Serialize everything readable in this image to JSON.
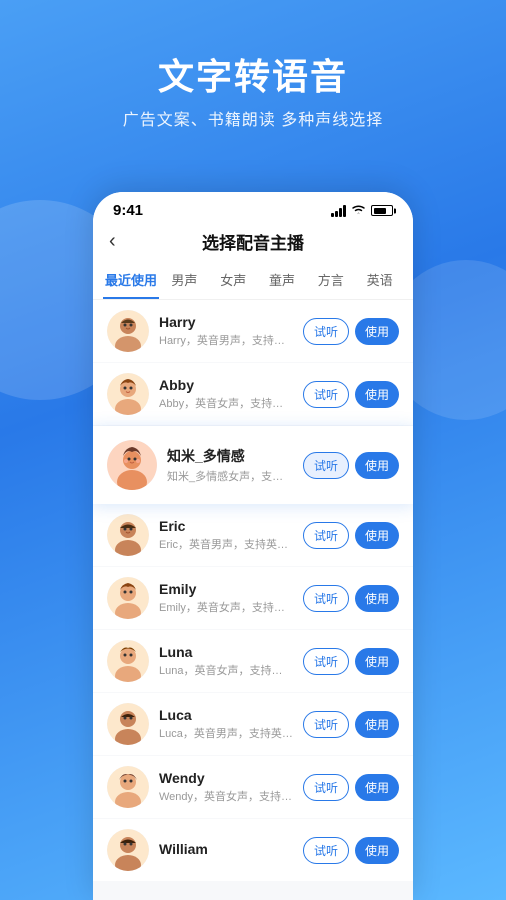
{
  "background": {
    "gradient_start": "#4a9ff5",
    "gradient_end": "#2979e8"
  },
  "header": {
    "main_title": "文字转语音",
    "sub_title": "广告文案、书籍朗读 多种声线选择"
  },
  "status_bar": {
    "time": "9:41",
    "signal_alt": "signal",
    "wifi_alt": "wifi",
    "battery_alt": "battery"
  },
  "nav": {
    "back_icon": "‹",
    "title": "选择配音主播"
  },
  "tabs": [
    {
      "label": "最近使用",
      "active": true
    },
    {
      "label": "男声",
      "active": false
    },
    {
      "label": "女声",
      "active": false
    },
    {
      "label": "童声",
      "active": false
    },
    {
      "label": "方言",
      "active": false
    },
    {
      "label": "英语",
      "active": false
    }
  ],
  "voice_list": [
    {
      "name": "Harry",
      "desc": "Harry，英音男声，支持英文场景",
      "highlighted": false
    },
    {
      "name": "Abby",
      "desc": "Abby，英音女声，支持英文场景",
      "highlighted": false
    },
    {
      "name": "知米_多情感",
      "desc": "知米_多情感女声，支持中文及中英文混合场景",
      "highlighted": true
    },
    {
      "name": "Eric",
      "desc": "Eric，英音男声，支持英文场景",
      "highlighted": false
    },
    {
      "name": "Emily",
      "desc": "Emily，英音女声，支持英文场景",
      "highlighted": false
    },
    {
      "name": "Luna",
      "desc": "Luna，英音女声，支持英文场景",
      "highlighted": false
    },
    {
      "name": "Luca",
      "desc": "Luca，英音男声，支持英文场景",
      "highlighted": false
    },
    {
      "name": "Wendy",
      "desc": "Wendy，英音女声，支持英文场景",
      "highlighted": false
    },
    {
      "name": "William",
      "desc": "",
      "highlighted": false
    }
  ],
  "buttons": {
    "try": "试听",
    "use": "使用"
  }
}
